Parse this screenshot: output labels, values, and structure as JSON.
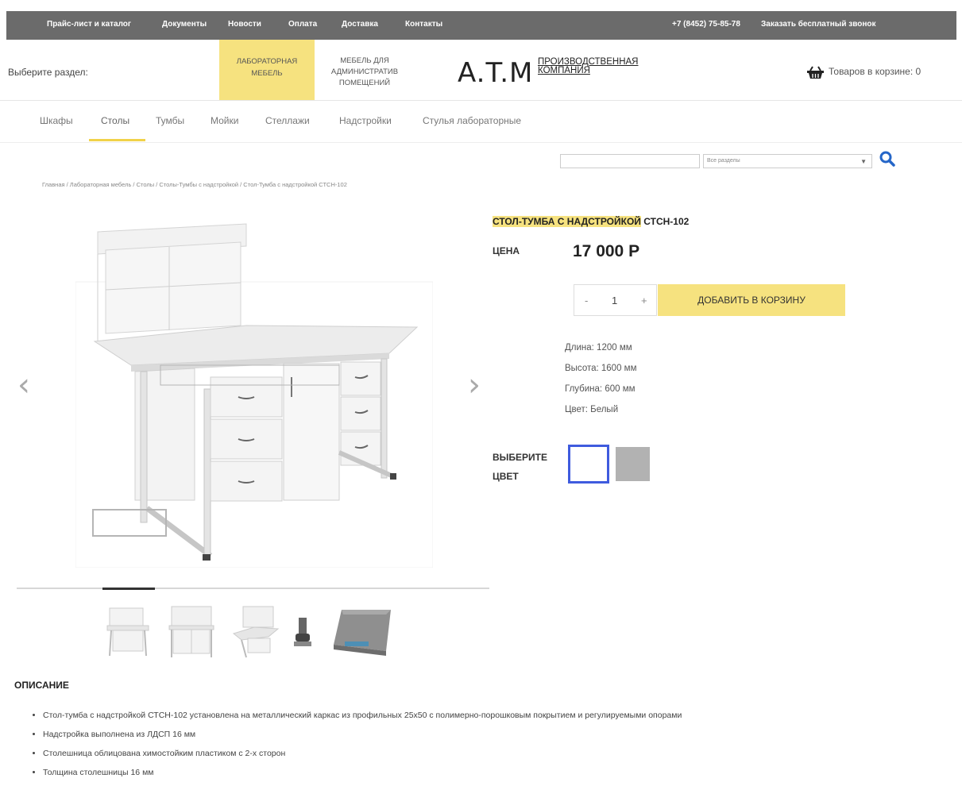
{
  "topbar": {
    "links": [
      "Прайс-лист и каталог",
      "Документы",
      "Новости",
      "Оплата",
      "Доставка",
      "Контакты"
    ],
    "phone": "+7 (8452) 75-85-78",
    "callback": "Заказать бесплатный звонок"
  },
  "header": {
    "select_section": "Выберите раздел:",
    "section_active_line1": "ЛАБОРАТОРНАЯ",
    "section_active_line2": "МЕБЕЛЬ",
    "section_2_line1": "МЕБЕЛЬ ДЛЯ",
    "section_2_line2": "АДМИНИСТРАТИВ",
    "section_2_line3": "ПОМЕЩЕНИЙ",
    "logo": "A.T.M",
    "logo_sub1": "ПРОИЗВОДСТВЕННАЯ",
    "logo_sub2": "КОМПАНИЯ",
    "cart": "Товаров в корзине: 0"
  },
  "catnav": [
    "Шкафы",
    "Столы",
    "Тумбы",
    "Мойки",
    "Стеллажи",
    "Надстройки",
    "Стулья лабораторные"
  ],
  "search": {
    "value": "",
    "select": "Все разделы"
  },
  "breadcrumb": "Главная / Лабораторная мебель / Столы / Столы-Тумбы с надстройкой / Стол-Тумба с надстройкой СТСН-102",
  "product": {
    "title_hl": "СТОЛ-ТУМБА С НАДСТРОЙКОЙ",
    "title_rest": " СТСН-102",
    "price_label": "ЦЕНА",
    "price": "17 000 Р",
    "qty_minus": "-",
    "qty": "1",
    "qty_plus": "+",
    "add_to_cart": "ДОБАВИТЬ В КОРЗИНУ",
    "specs": [
      "Длина: 1200 мм",
      "Высота: 1600 мм",
      "Глубина: 600 мм",
      "Цвет: Белый"
    ],
    "color_label1": "ВЫБЕРИТЕ",
    "color_label2": "ЦВЕТ",
    "colors": [
      "#ffffff",
      "#b2b2b2"
    ]
  },
  "description": {
    "title": "ОПИСАНИЕ",
    "items": [
      "Стол-тумба с надстройкой СТСН-102 установлена на металлический каркас из профильных 25х50 с полимерно-порошковым покрытием и регулируемыми опорами",
      "Надстройка выполнена из ЛДСП 16 мм",
      "Столешница облицована химостойким  пластиком с 2-х сторон",
      "Толщина столешницы 16 мм"
    ]
  }
}
